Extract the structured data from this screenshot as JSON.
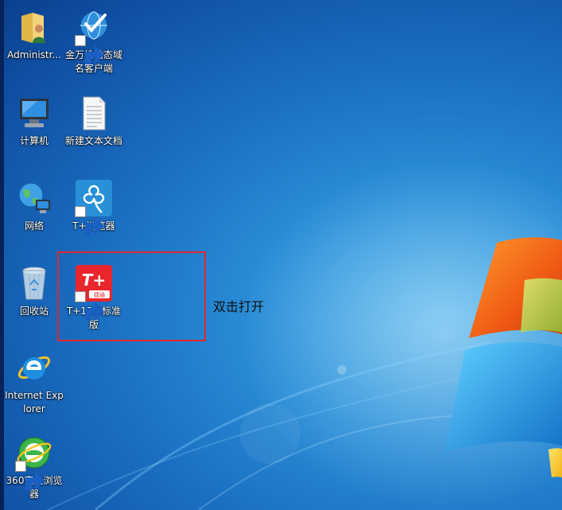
{
  "desktop": {
    "icons": [
      {
        "label": "Administr...",
        "icon": "user-folder-icon"
      },
      {
        "label": "金万维动态域名客户端",
        "icon": "dynamic-dns-client-icon"
      },
      {
        "label": "计算机",
        "icon": "computer-icon"
      },
      {
        "label": "新建文本文档",
        "icon": "text-document-icon"
      },
      {
        "label": "网络",
        "icon": "network-icon"
      },
      {
        "label": "T+浏览器",
        "icon": "tplus-browser-icon"
      },
      {
        "label": "回收站",
        "icon": "recycle-bin-icon"
      },
      {
        "label": "T+13.0标准版",
        "icon": "tplus-app-icon"
      },
      {
        "label": "Internet Explorer",
        "icon": "internet-explorer-icon"
      },
      {
        "label": "360安全浏览器",
        "icon": "360-browser-icon"
      }
    ],
    "tplus_badge": {
      "text": "T+",
      "subtext": "捷通"
    }
  },
  "annotation": {
    "text": "双击打开"
  },
  "colors": {
    "highlight_border": "#e0282e",
    "tplus_red": "#e8262c",
    "tplus_blue": "#2790d8"
  }
}
